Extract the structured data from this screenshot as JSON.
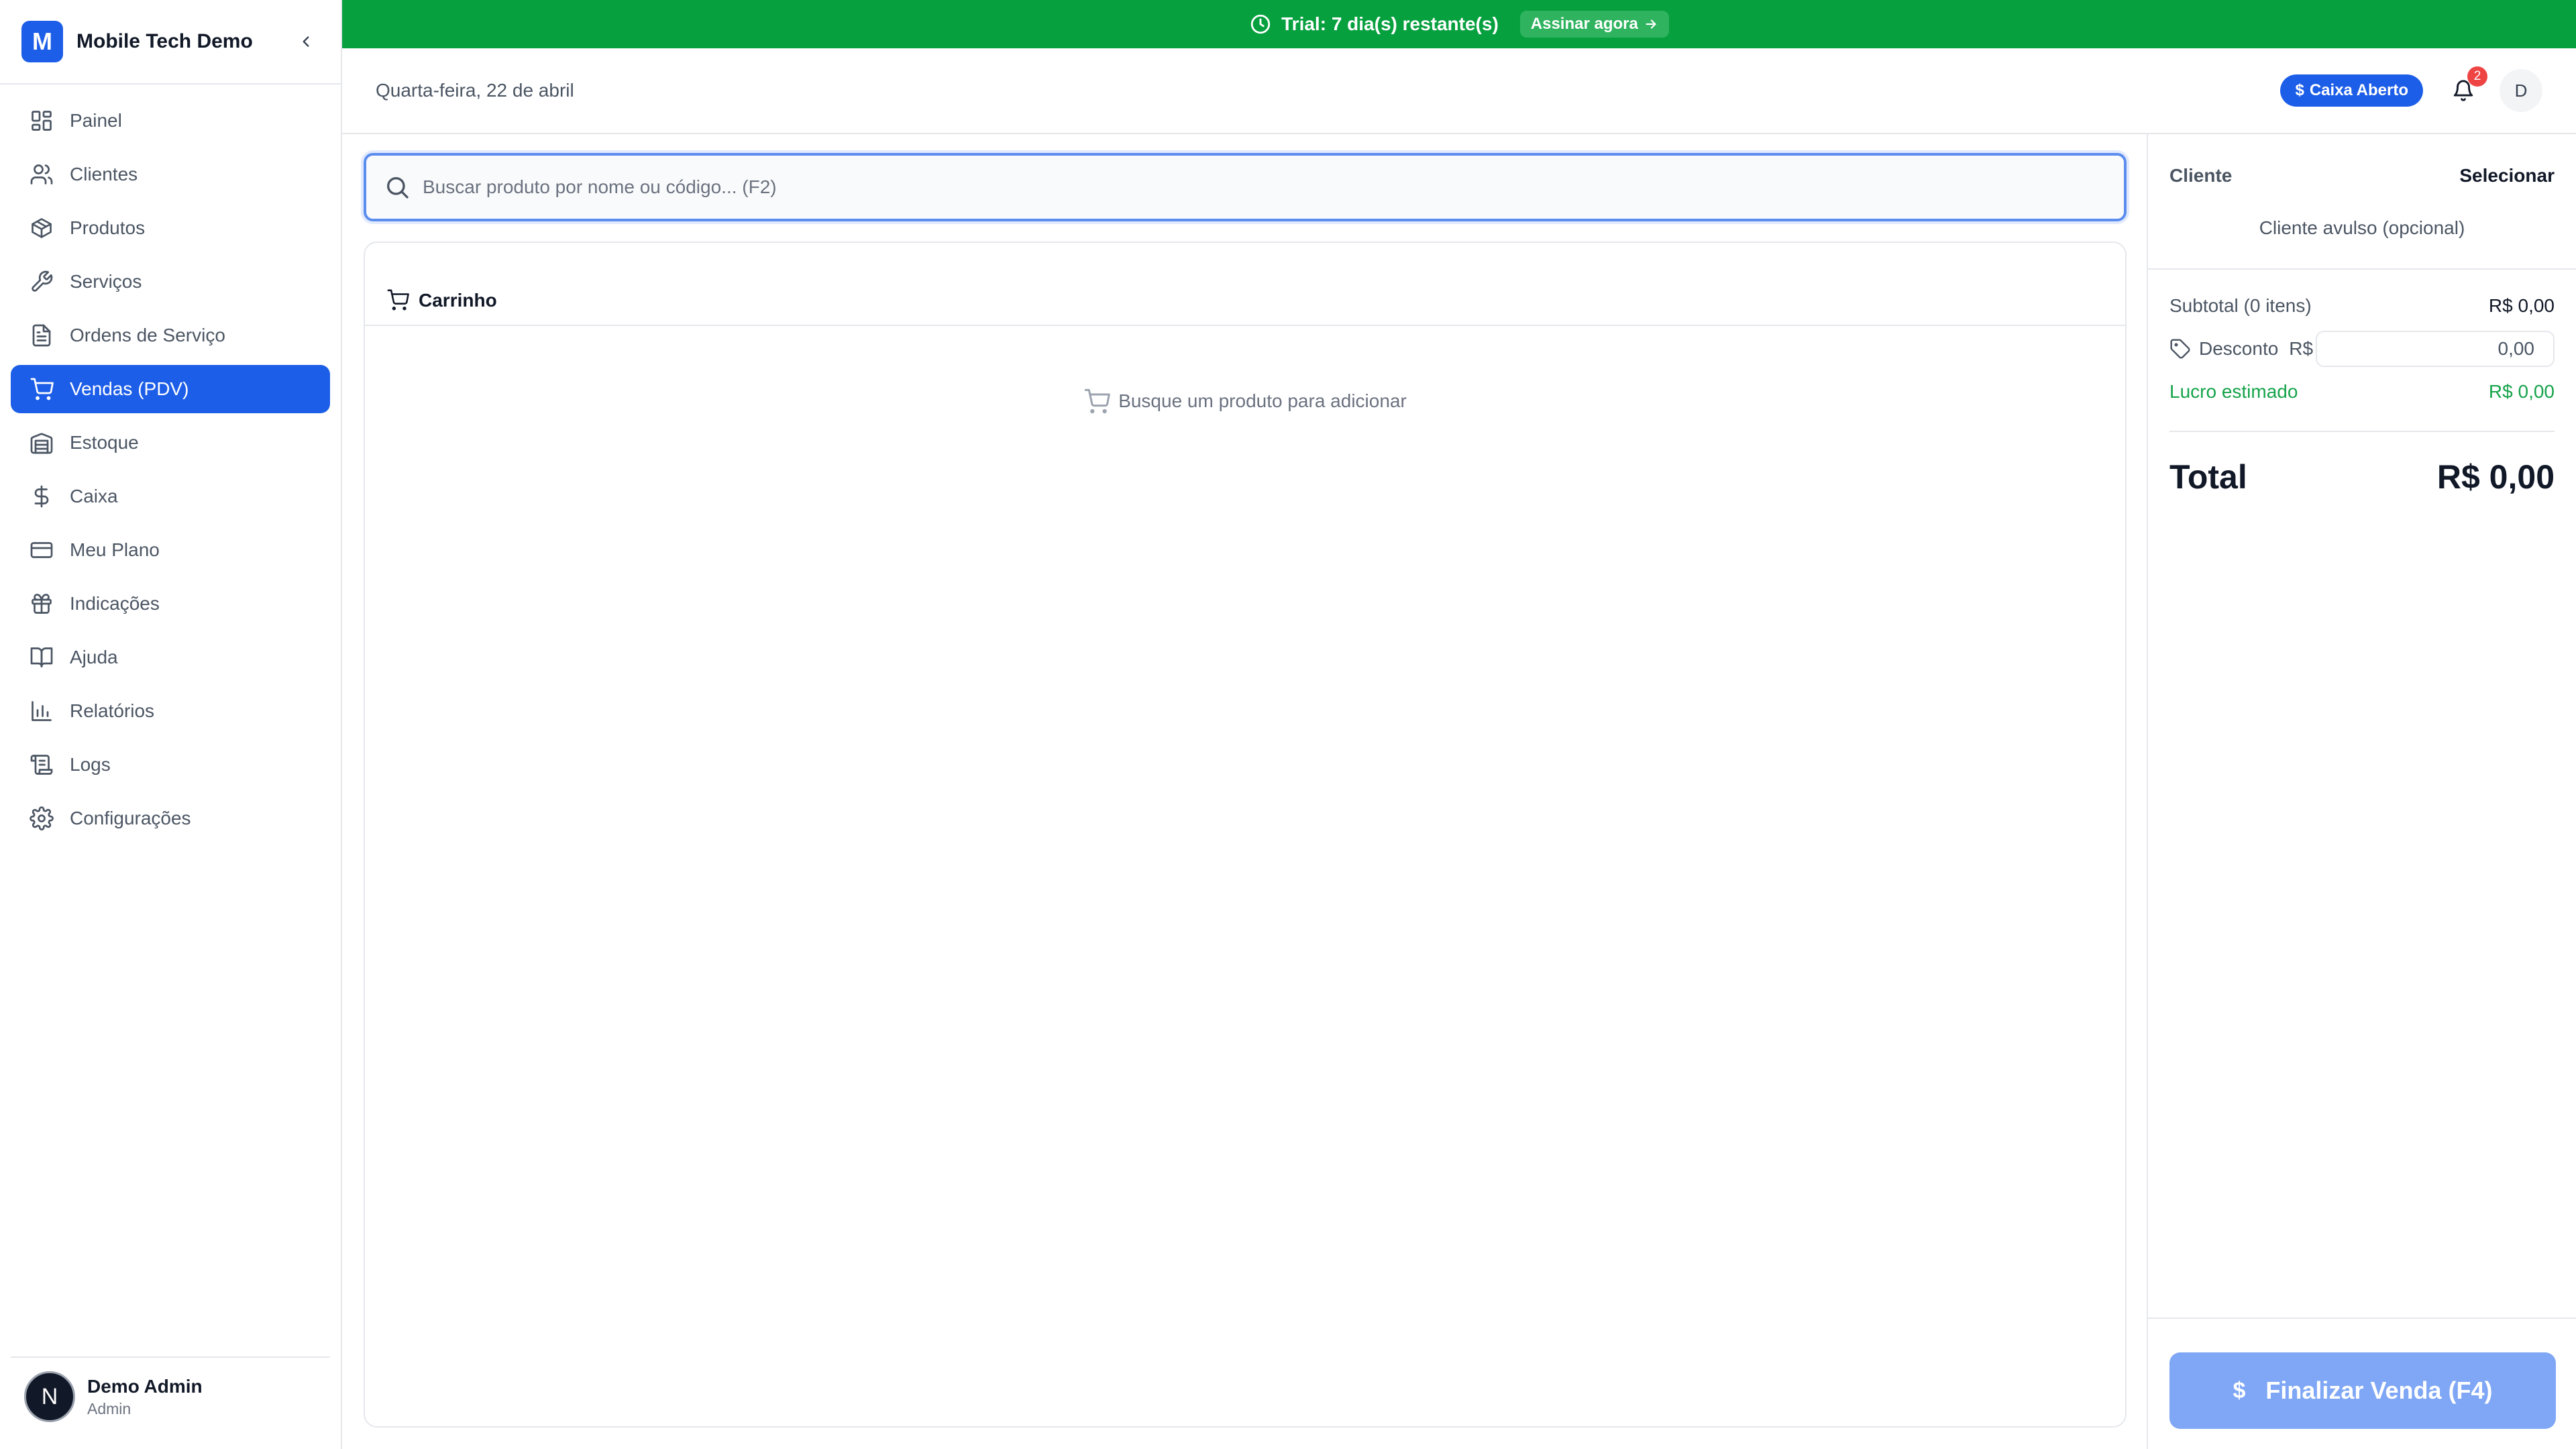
{
  "app": {
    "logo_letter": "M",
    "name": "Mobile Tech Demo"
  },
  "sidebar": {
    "items": [
      {
        "label": "Painel",
        "icon": "layout-dashboard-icon"
      },
      {
        "label": "Clientes",
        "icon": "users-icon"
      },
      {
        "label": "Produtos",
        "icon": "package-icon"
      },
      {
        "label": "Serviços",
        "icon": "wrench-icon"
      },
      {
        "label": "Ordens de Serviço",
        "icon": "file-text-icon"
      },
      {
        "label": "Vendas (PDV)",
        "icon": "shopping-cart-icon",
        "active": true
      },
      {
        "label": "Estoque",
        "icon": "warehouse-icon"
      },
      {
        "label": "Caixa",
        "icon": "dollar-sign-icon"
      },
      {
        "label": "Meu Plano",
        "icon": "credit-card-icon"
      },
      {
        "label": "Indicações",
        "icon": "gift-icon"
      },
      {
        "label": "Ajuda",
        "icon": "book-open-icon"
      },
      {
        "label": "Relatórios",
        "icon": "bar-chart-icon"
      },
      {
        "label": "Logs",
        "icon": "scroll-text-icon"
      },
      {
        "label": "Configurações",
        "icon": "settings-icon"
      }
    ],
    "user": {
      "avatar_letter": "N",
      "name": "Demo Admin",
      "role": "Admin"
    }
  },
  "trial": {
    "text": "Trial: 7 dia(s) restante(s)",
    "cta": "Assinar agora"
  },
  "header": {
    "date": "Quarta-feira, 22 de abril",
    "cash_status": "Caixa Aberto",
    "notification_count": "2",
    "avatar_letter": "D"
  },
  "search": {
    "placeholder": "Buscar produto por nome ou código... (F2)",
    "value": ""
  },
  "cart": {
    "title": "Carrinho",
    "empty_message": "Busque um produto para adicionar"
  },
  "summary": {
    "client_label": "Cliente",
    "client_select": "Selecionar",
    "client_walkin": "Cliente avulso (opcional)",
    "subtotal_label": "Subtotal (0 itens)",
    "subtotal_value": "R$ 0,00",
    "discount_label": "Desconto",
    "discount_currency": "R$",
    "discount_value": "0,00",
    "profit_label": "Lucro estimado",
    "profit_value": "R$ 0,00",
    "total_label": "Total",
    "total_value": "R$ 0,00",
    "finish_label": "Finalizar Venda (F4)"
  },
  "colors": {
    "primary": "#1d5ee8",
    "trial_green": "#07a03f",
    "profit_green": "#16a34a",
    "finish_disabled": "#7fa7f5",
    "badge_red": "#ef4444"
  }
}
